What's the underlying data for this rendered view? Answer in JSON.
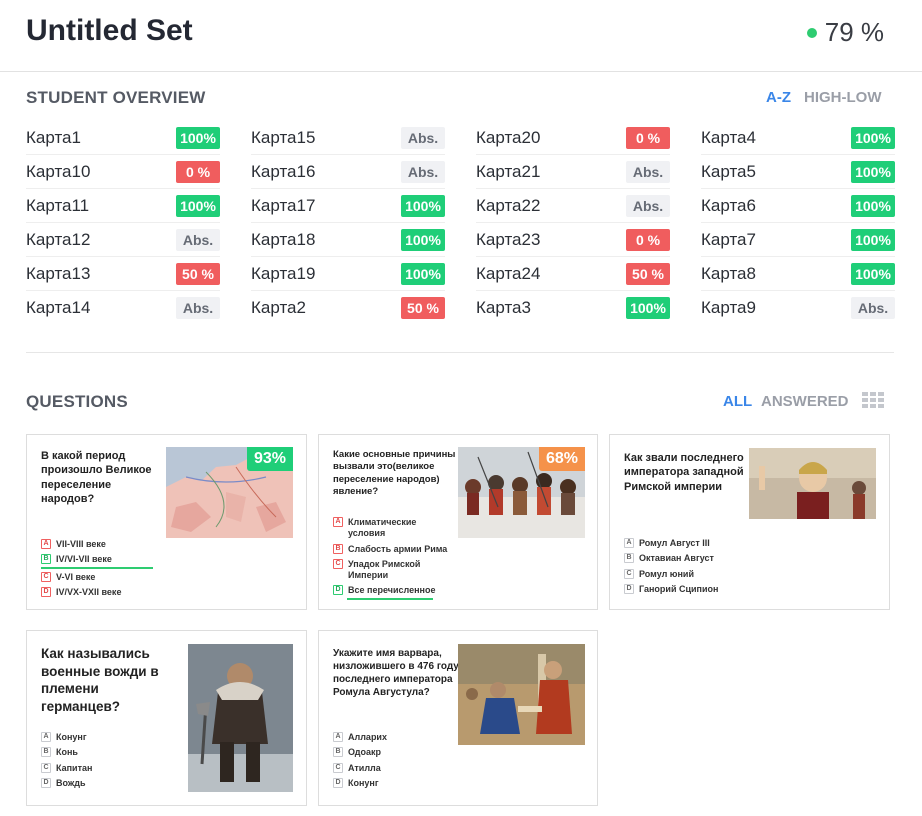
{
  "header": {
    "title": "Untitled Set",
    "score": "79 %"
  },
  "overview": {
    "title": "STUDENT OVERVIEW",
    "sort_az": "A-Z",
    "sort_high_low": "HIGH-LOW",
    "columns": [
      [
        {
          "name": "Карта1",
          "score": "100%",
          "status": "green"
        },
        {
          "name": "Карта10",
          "score": "0 %",
          "status": "red"
        },
        {
          "name": "Карта11",
          "score": "100%",
          "status": "green"
        },
        {
          "name": "Карта12",
          "score": "Abs.",
          "status": "abs"
        },
        {
          "name": "Карта13",
          "score": "50 %",
          "status": "red"
        },
        {
          "name": "Карта14",
          "score": "Abs.",
          "status": "abs"
        }
      ],
      [
        {
          "name": "Карта15",
          "score": "Abs.",
          "status": "abs"
        },
        {
          "name": "Карта16",
          "score": "Abs.",
          "status": "abs"
        },
        {
          "name": "Карта17",
          "score": "100%",
          "status": "green"
        },
        {
          "name": "Карта18",
          "score": "100%",
          "status": "green"
        },
        {
          "name": "Карта19",
          "score": "100%",
          "status": "green"
        },
        {
          "name": "Карта2",
          "score": "50 %",
          "status": "red"
        }
      ],
      [
        {
          "name": "Карта20",
          "score": "0 %",
          "status": "red"
        },
        {
          "name": "Карта21",
          "score": "Abs.",
          "status": "abs"
        },
        {
          "name": "Карта22",
          "score": "Abs.",
          "status": "abs"
        },
        {
          "name": "Карта23",
          "score": "0 %",
          "status": "red"
        },
        {
          "name": "Карта24",
          "score": "50 %",
          "status": "red"
        },
        {
          "name": "Карта3",
          "score": "100%",
          "status": "green"
        }
      ],
      [
        {
          "name": "Карта4",
          "score": "100%",
          "status": "green"
        },
        {
          "name": "Карта5",
          "score": "100%",
          "status": "green"
        },
        {
          "name": "Карта6",
          "score": "100%",
          "status": "green"
        },
        {
          "name": "Карта7",
          "score": "100%",
          "status": "green"
        },
        {
          "name": "Карта8",
          "score": "100%",
          "status": "green"
        },
        {
          "name": "Карта9",
          "score": "Abs.",
          "status": "abs"
        }
      ]
    ]
  },
  "questions_section": {
    "title": "QUESTIONS",
    "filter_all": "ALL",
    "filter_answered": "ANSWERED"
  },
  "questions": [
    {
      "text": "В какой период произошло Великое переселение народов?",
      "percent": "93%",
      "percent_color": "#1fce78",
      "image": "map-of-europe",
      "answers": [
        {
          "letter": "A",
          "text": "VII-VIII веке",
          "state": "wrong"
        },
        {
          "letter": "B",
          "text": "IV/VI-VII веке",
          "state": "right"
        },
        {
          "letter": "C",
          "text": "V-VI веке",
          "state": "wrong"
        },
        {
          "letter": "D",
          "text": "IV/VX-VXII веке",
          "state": "wrong"
        }
      ]
    },
    {
      "text": "Какие основные причины вызвали это(великое переселение народов) явление?",
      "percent": "68%",
      "percent_color": "#f5924a",
      "image": "battle-painting",
      "answers": [
        {
          "letter": "A",
          "text": "Климатические условия",
          "state": "wrong"
        },
        {
          "letter": "B",
          "text": "Слабость армии Рима",
          "state": "wrong"
        },
        {
          "letter": "C",
          "text": "Упадок Римской Империи",
          "state": "wrong"
        },
        {
          "letter": "D",
          "text": "Все перечисленное",
          "state": "right"
        }
      ]
    },
    {
      "text": "Как звали последнего императора западной Римской империи",
      "percent": "",
      "percent_color": "",
      "image": "young-emperor-still",
      "answers": [
        {
          "letter": "A",
          "text": "Ромул Август III",
          "state": "none"
        },
        {
          "letter": "B",
          "text": "Октавиан Август",
          "state": "none"
        },
        {
          "letter": "C",
          "text": "Ромул юний",
          "state": "none"
        },
        {
          "letter": "D",
          "text": "Ганорий Сципион",
          "state": "none"
        }
      ]
    },
    {
      "text": "Как назывались военные вожди в племени германцев?",
      "percent": "",
      "percent_color": "",
      "image": "barbarian-warrior",
      "answers": [
        {
          "letter": "A",
          "text": "Конунг",
          "state": "none"
        },
        {
          "letter": "B",
          "text": "Конь",
          "state": "none"
        },
        {
          "letter": "C",
          "text": "Капитан",
          "state": "none"
        },
        {
          "letter": "D",
          "text": "Вождь",
          "state": "none"
        }
      ]
    },
    {
      "text": "Укажите имя варвара, низложившего в 476 году последнего императора Ромула Августула?",
      "percent": "",
      "percent_color": "",
      "image": "deposition-painting",
      "answers": [
        {
          "letter": "A",
          "text": "Алларих",
          "state": "none"
        },
        {
          "letter": "B",
          "text": "Одоакр",
          "state": "none"
        },
        {
          "letter": "C",
          "text": "Атилла",
          "state": "none"
        },
        {
          "letter": "D",
          "text": "Конунг",
          "state": "none"
        }
      ]
    }
  ]
}
